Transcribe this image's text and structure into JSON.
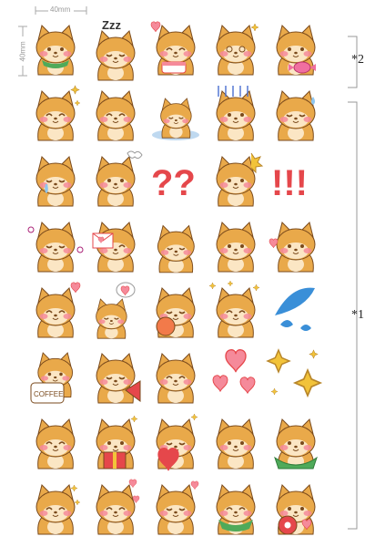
{
  "dimensions": {
    "width_label": "40mm",
    "height_label": "40mm"
  },
  "groups": [
    {
      "label": "*2"
    },
    {
      "label": "*1"
    }
  ],
  "stickers": [
    [
      "shiba-green-scarf",
      "shiba-sleeping-zzz",
      "shiba-with-cake",
      "shiba-dizzy",
      "shiba-with-candy"
    ],
    [
      "shiba-sparkle-happy",
      "shiba-blushing-smile",
      "shiba-lying-on-puddle",
      "shiba-gloomy",
      "shiba-sweating"
    ],
    [
      "shiba-crying",
      "shiba-angry-steam",
      "question-marks",
      "shiba-surprised",
      "exclamation-marks"
    ],
    [
      "shiba-hamster-hug",
      "shiba-with-envelope",
      "shiba-stretching",
      "shiba-pouting",
      "shiba-heart-eyes"
    ],
    [
      "shiba-heart-tail",
      "shiba-thinking-heart",
      "shiba-holding-ball",
      "shiba-sparkles-happy",
      "water-drops"
    ],
    [
      "shiba-coffee-cup",
      "shiba-megaphone",
      "shiba-sitting-back",
      "pink-hearts",
      "gold-sparkles"
    ],
    [
      "shiba-smiling",
      "shiba-gift-box",
      "shiba-hugging-heart",
      "shiba-blushing",
      "shiba-in-basket"
    ],
    [
      "shiba-sparkle-paws",
      "shiba-hearts",
      "shiba-bottom-wag",
      "shiba-green-bandana",
      "shiba-donut"
    ]
  ],
  "texts": {
    "zzz": "Zzz",
    "questions": "??",
    "exclamations": "!!!",
    "coffee": "COFFEE"
  },
  "colors": {
    "fur": "#E9A94A",
    "fur_light": "#FBE6C4",
    "outline": "#7A4A1C",
    "blush": "#F58A9A",
    "red": "#E5474B",
    "gold": "#F2C33A",
    "blue": "#3A8FD8"
  }
}
